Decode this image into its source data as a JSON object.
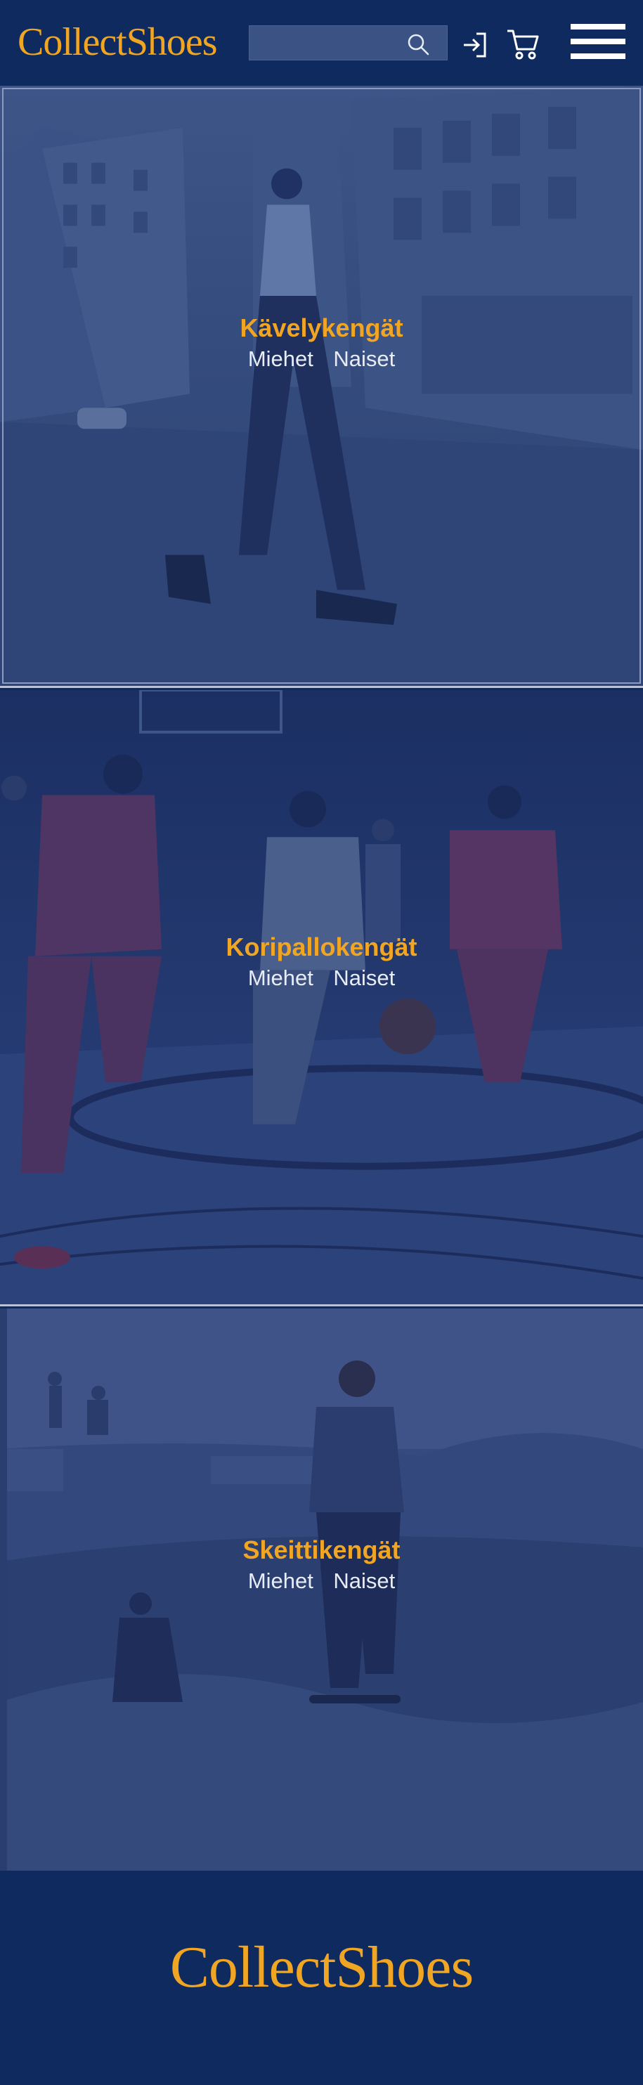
{
  "header": {
    "logo_text": "CollectShoes",
    "search": {
      "placeholder": "",
      "value": ""
    },
    "icons": {
      "search": "search-icon",
      "login": "login-icon",
      "cart": "cart-icon",
      "menu": "hamburger-menu-icon"
    }
  },
  "categories": [
    {
      "title": "Kävelykengät",
      "links": [
        "Miehet",
        "Naiset"
      ]
    },
    {
      "title": "Koripallokengät",
      "links": [
        "Miehet",
        "Naiset"
      ]
    },
    {
      "title": "Skeittikengät",
      "links": [
        "Miehet",
        "Naiset"
      ]
    }
  ],
  "footer": {
    "logo_text": "CollectShoes"
  },
  "colors": {
    "brand_navy": "#0f2a5f",
    "accent_gold": "#f0a523",
    "search_bg": "#3b5384",
    "link_text": "#e8ecf5"
  }
}
